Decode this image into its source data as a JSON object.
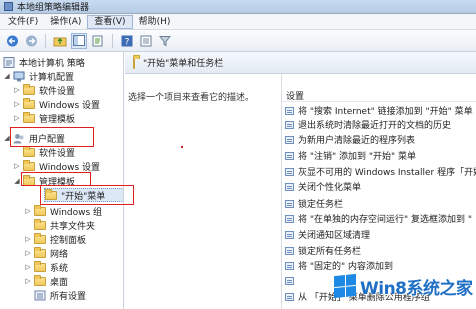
{
  "window": {
    "title": "本地组策略编辑器"
  },
  "menu": [
    {
      "label": "文件(F)",
      "active": false
    },
    {
      "label": "操作(A)",
      "active": false
    },
    {
      "label": "查看(V)",
      "active": true
    },
    {
      "label": "帮助(H)",
      "active": false
    }
  ],
  "toolbar": {
    "icons": [
      "back-arrow-icon",
      "forward-arrow-icon",
      "up-folder-icon",
      "show-hide-tree-icon",
      "export-list-icon",
      "help-icon",
      "properties-icon",
      "filter-icon"
    ]
  },
  "tree": {
    "root_label": "本地计算机 策略",
    "computer_config": "计算机配置",
    "cc_software": "软件设置",
    "cc_windows": "Windows 设置",
    "cc_admin": "管理模板",
    "user_config": "用户配置",
    "uc_software": "软件设置",
    "uc_windows": "Windows 设置",
    "uc_admin": "管理模板",
    "start_menu": "\"开始\"菜单",
    "windows_components": "Windows 组",
    "shared_folders": "共享文件夹",
    "control_panel": "控制面板",
    "network": "网络",
    "system": "系统",
    "desktop": "桌面",
    "all_settings": "所有设置"
  },
  "right": {
    "header": "\"开始\"菜单和任务栏",
    "description": "选择一个项目来查看它的描述。",
    "column_header": "设置",
    "settings": [
      "将 \"搜索 Internet\" 链接添加到 \"开始\" 菜单",
      "退出系统时清除最近打开的文档的历史",
      "为新用户清除最近的程序列表",
      "将 \"注销\" 添加到 \"开始\" 菜单",
      "灰显不可用的 Windows Installer 程序「开始",
      "关闭个性化菜单",
      "锁定任务栏",
      "将 \"在单独的内存空间运行\" 复选框添加到 \"",
      "关闭通知区域清理",
      "锁定所有任务栏",
      "将 \"固定的\" 内容添加到",
      "",
      "从 「开始」 菜单删除公用程序组"
    ]
  },
  "watermark": {
    "text": "Win8系统之家"
  },
  "colors": {
    "highlight_box": "#e02020",
    "selection": "#dde8f6",
    "accent": "#1f6fc4"
  }
}
